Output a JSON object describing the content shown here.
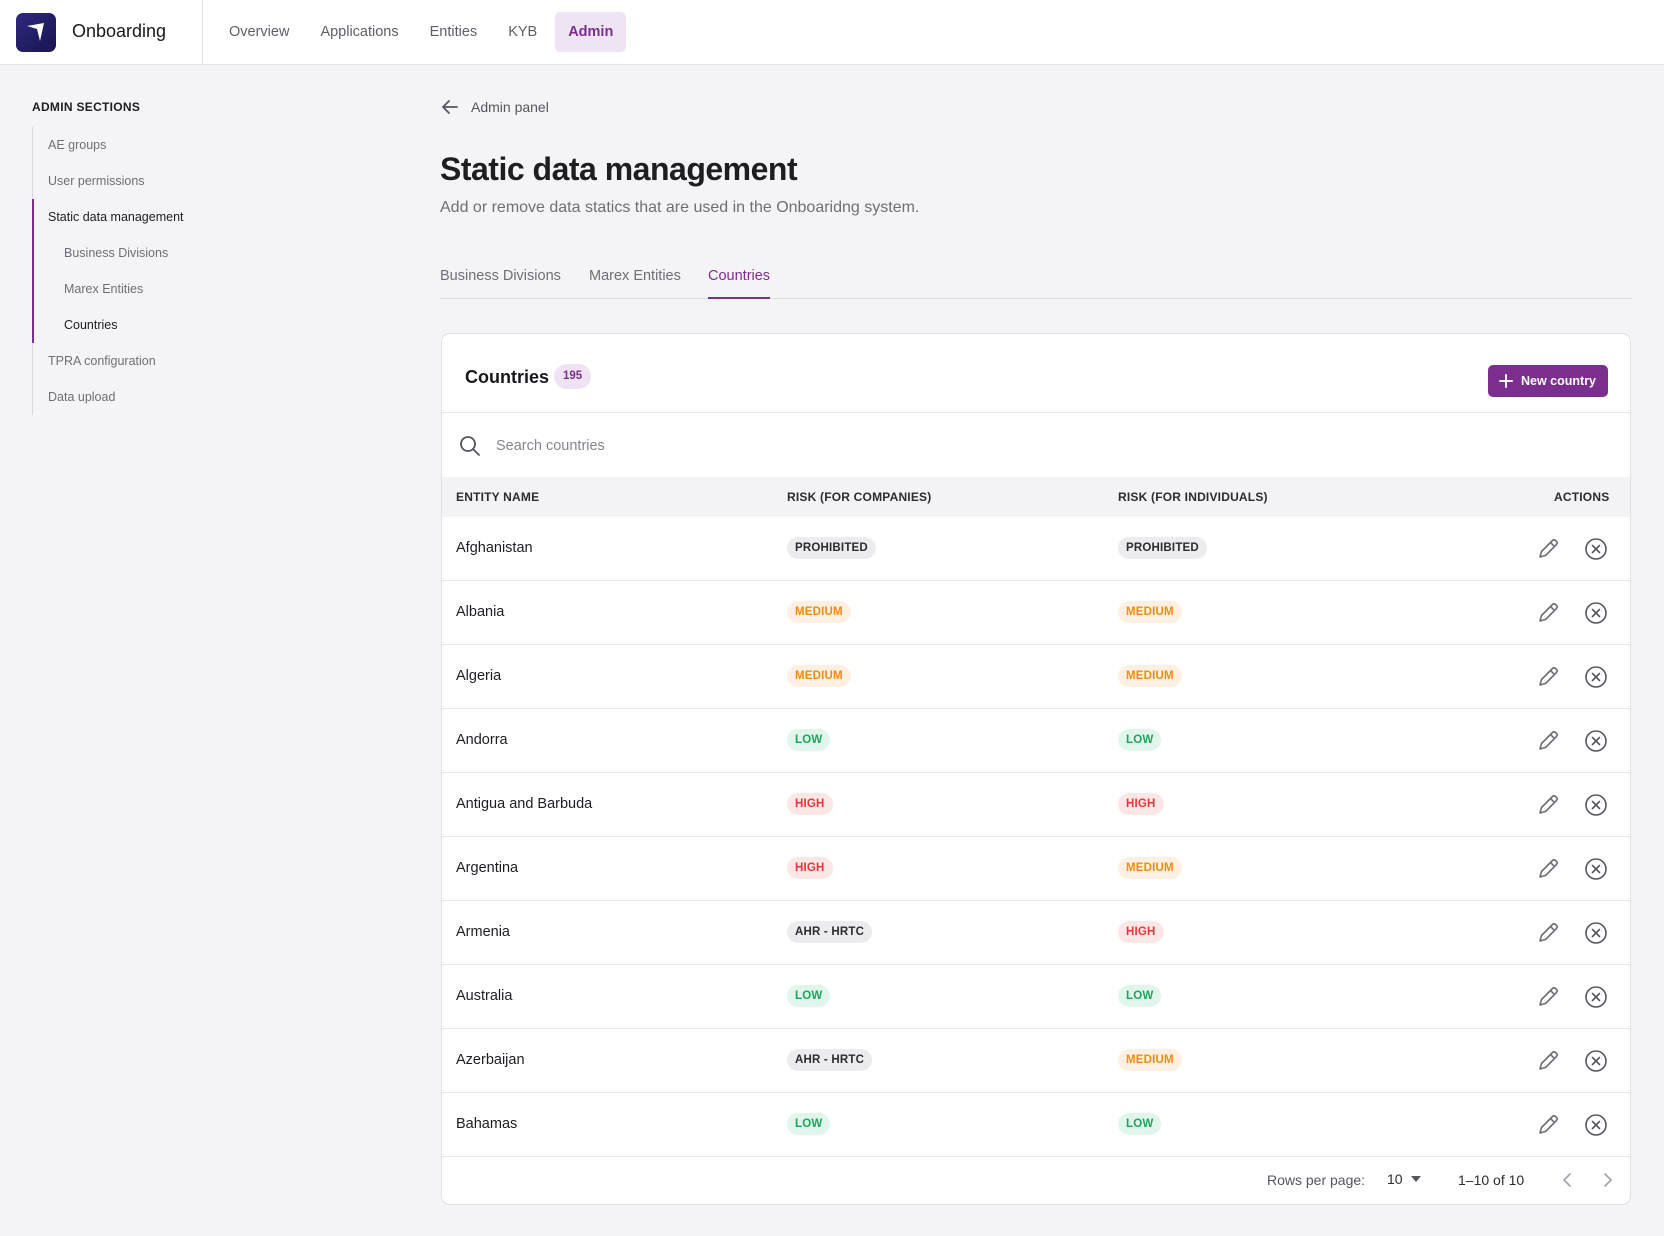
{
  "app": {
    "name": "Onboarding"
  },
  "nav": [
    {
      "label": "Overview",
      "active": false
    },
    {
      "label": "Applications",
      "active": false
    },
    {
      "label": "Entities",
      "active": false
    },
    {
      "label": "KYB",
      "active": false
    },
    {
      "label": "Admin",
      "active": true
    }
  ],
  "sidebar": {
    "heading": "ADMIN SECTIONS",
    "items": [
      {
        "label": "AE groups"
      },
      {
        "label": "User permissions"
      },
      {
        "label": "Static data management"
      },
      {
        "label": "Business Divisions"
      },
      {
        "label": "Marex Entities"
      },
      {
        "label": "Countries"
      },
      {
        "label": "TPRA configuration"
      },
      {
        "label": "Data upload"
      }
    ]
  },
  "breadcrumb": {
    "back_label": "Admin panel"
  },
  "page": {
    "title": "Static data management",
    "subtitle": "Add or remove data statics that are used in the Onboaridng system."
  },
  "tabs": [
    {
      "label": "Business Divisions",
      "active": false
    },
    {
      "label": "Marex Entities",
      "active": false
    },
    {
      "label": "Countries",
      "active": true
    }
  ],
  "card": {
    "title": "Countries",
    "count": "195",
    "new_button": "New country",
    "search_placeholder": "Search countries"
  },
  "table": {
    "columns": [
      "ENTITY NAME",
      "RISK (FOR COMPANIES)",
      "RISK (FOR INDIVIDUALS)",
      "ACTIONS"
    ],
    "rows": [
      {
        "name": "Afghanistan",
        "risk_companies": "PROHIBITED",
        "risk_individuals": "PROHIBITED"
      },
      {
        "name": "Albania",
        "risk_companies": "MEDIUM",
        "risk_individuals": "MEDIUM"
      },
      {
        "name": "Algeria",
        "risk_companies": "MEDIUM",
        "risk_individuals": "MEDIUM"
      },
      {
        "name": "Andorra",
        "risk_companies": "LOW",
        "risk_individuals": "LOW"
      },
      {
        "name": "Antigua and Barbuda",
        "risk_companies": "HIGH",
        "risk_individuals": "HIGH"
      },
      {
        "name": "Argentina",
        "risk_companies": "HIGH",
        "risk_individuals": "MEDIUM"
      },
      {
        "name": "Armenia",
        "risk_companies": "AHR - HRTC",
        "risk_individuals": "HIGH"
      },
      {
        "name": "Australia",
        "risk_companies": "LOW",
        "risk_individuals": "LOW"
      },
      {
        "name": "Azerbaijan",
        "risk_companies": "AHR - HRTC",
        "risk_individuals": "MEDIUM"
      },
      {
        "name": "Bahamas",
        "risk_companies": "LOW",
        "risk_individuals": "LOW"
      }
    ]
  },
  "pagination": {
    "rows_per_page_label": "Rows per page:",
    "rows_per_page": "10",
    "range": "1–10 of 10"
  },
  "colors": {
    "accent": "#7b2e8e",
    "risk_low": "#1aa55d",
    "risk_medium": "#ed8d0f",
    "risk_high": "#e4393a",
    "risk_neutral": "#2b2b31"
  },
  "icons": {
    "logo": "logo-icon",
    "back": "arrow-left-icon",
    "add": "plus-icon",
    "search": "search-icon",
    "edit": "pencil-icon",
    "delete": "close-circle-icon",
    "dropdown": "caret-down-icon",
    "prev": "chevron-left-icon",
    "next": "chevron-right-icon"
  }
}
